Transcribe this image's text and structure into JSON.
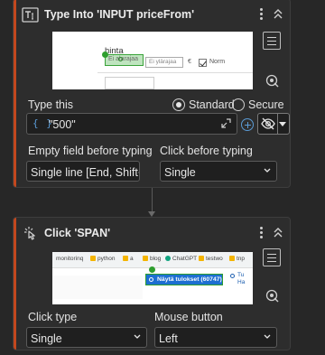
{
  "actions": [
    {
      "title": "Type Into 'INPUT priceFrom'",
      "thumbnail": {
        "heading": "hinta",
        "field1_placeholder": "Ei alarajaa",
        "field2_placeholder": "Ei ylärajaa",
        "currency": "€",
        "checkbox_label": "Norm"
      },
      "type_this_label": "Type this",
      "mode_options": [
        {
          "label": "Standard",
          "selected": true
        },
        {
          "label": "Secure",
          "selected": false
        }
      ],
      "text_value": "\"500\"",
      "empty_field_label": "Empty field before typing",
      "empty_field_value": "Single line [End, Shift+Home, Delete]",
      "click_before_label": "Click before typing",
      "click_before_value": "Single"
    },
    {
      "title": "Click 'SPAN'",
      "thumbnail": {
        "bookmarks": [
          "monitorinq",
          "python",
          "a",
          "blog",
          "ChatGPT",
          "testwo",
          "tnp"
        ],
        "button_text": "Näytä tulokset (60747)",
        "side_text_1": "Tu",
        "side_text_2": "Ha"
      },
      "click_type_label": "Click type",
      "click_type_value": "Single",
      "mouse_button_label": "Mouse button",
      "mouse_button_value": "Left"
    }
  ],
  "colors": {
    "accent_bar": "#c2471e",
    "expression_blue": "#5b9bd5",
    "selection_green": "#2e9e2e"
  }
}
